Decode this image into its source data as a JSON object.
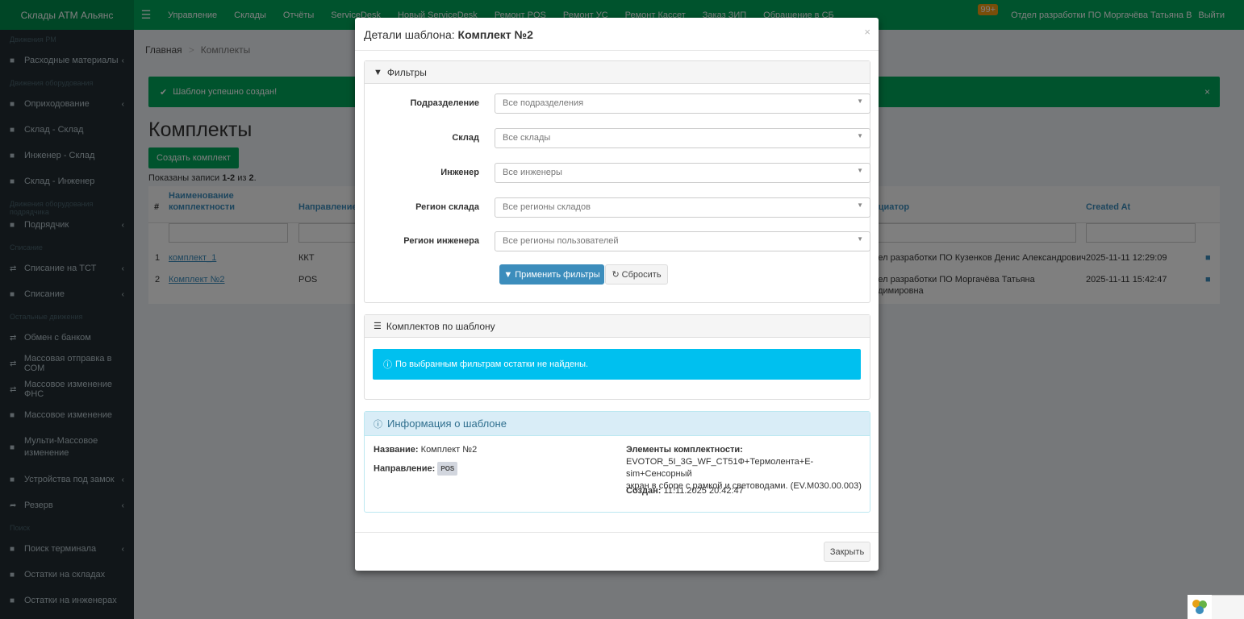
{
  "app": {
    "title": "Склады АТМ Альянс"
  },
  "topnav": [
    "Управление",
    "Склады",
    "Отчёты",
    "ServiceDesk",
    "Новый ServiceDesk",
    "Ремонт POS",
    "Ремонт УС",
    "Ремонт Кассет",
    "Заказ ЗИП",
    "Обращение в СБ"
  ],
  "topright": {
    "badge": "99+",
    "user": "Отдел разработки ПО Моргачёва Татьяна В",
    "logout": "Выйти"
  },
  "sidebar": {
    "head1": "Движения РМ",
    "head2": "Движения оборудования",
    "head3": "Движения оборудования подрядчика",
    "head4": "Списание",
    "head5": "Остальные движения",
    "head6": "Поиск",
    "items": [
      "Расходные материалы",
      "Оприходование",
      "Склад - Склад",
      "Инженер - Склад",
      "Склад - Инженер",
      "Подрядчик",
      "Списание на ТСТ",
      "Списание",
      "Обмен с банком",
      "Массовая отправка в СОМ",
      "Массовое изменение ФНС",
      "Массовое изменение",
      "Мульти-Массовое изменение",
      "Устройства под замок",
      "Резерв",
      "Поиск терминала",
      "Остатки на складах",
      "Остатки на инженерах"
    ]
  },
  "breadcrumb": {
    "home": "Главная",
    "current": "Комплекты"
  },
  "alert": {
    "text": "Шаблон успешно создан!",
    "close": "×"
  },
  "page": {
    "title": "Комплекты",
    "create_button": "Создать комплект",
    "summary_prefix": "Показаны записи",
    "summary_range": "1-2",
    "summary_mid": "из",
    "summary_total": "2",
    "summary_end": "."
  },
  "table": {
    "headers": {
      "num": "#",
      "name": "Наименование комплектности",
      "direction": "Направление",
      "initiator": "ициатор",
      "created": "Created At"
    },
    "rows": [
      {
        "num": "1",
        "name": "комплект_1",
        "direction": "ККТ",
        "initiator": "дел разработки ПО Кузенков Денис Александрович",
        "created": "2025-11-11 12:29:09"
      },
      {
        "num": "2",
        "name": "Комплект №2",
        "direction": "POS",
        "initiator": "дел разработки ПО Моргачёва Татьяна",
        "initiator2": "адимировна",
        "created": "2025-11-11 15:42:47"
      }
    ]
  },
  "modal": {
    "title_prefix": "Детали шаблона:",
    "title_name": "Комплект №2",
    "close": "×",
    "filters": {
      "heading": "Фильтры",
      "rows": [
        {
          "label": "Подразделение",
          "placeholder": "Все подразделения"
        },
        {
          "label": "Склад",
          "placeholder": "Все склады"
        },
        {
          "label": "Инженер",
          "placeholder": "Все инженеры"
        },
        {
          "label": "Регион склада",
          "placeholder": "Все регионы складов"
        },
        {
          "label": "Регион инженера",
          "placeholder": "Все регионы пользователей"
        }
      ],
      "apply": "Применить фильтры",
      "reset": "Сбросить"
    },
    "kits": {
      "heading": "Комплектов по шаблону",
      "empty": "По выбранным фильтрам остатки не найдены."
    },
    "info": {
      "heading": "Информация о шаблоне",
      "name_label": "Название:",
      "name_value": "Комплект №2",
      "direction_label": "Направление:",
      "direction_value": "POS",
      "elements_label": "Элементы комплектности:",
      "elements_line1": "EVOTOR_5I_3G_WF_CT51Ф+Термолента+E-sim+Сенсорный",
      "elements_line2": "экран в сборе с рамкой и световодами. (EV.M030.00.003)",
      "created_label": "Создан:",
      "created_value": "11.11.2025 20:42:47"
    },
    "footer_close": "Закрыть"
  },
  "colors": {
    "brand": "#00a65a",
    "sidebar": "#222d32",
    "primary": "#3c8dbc",
    "info": "#00c0ef"
  }
}
